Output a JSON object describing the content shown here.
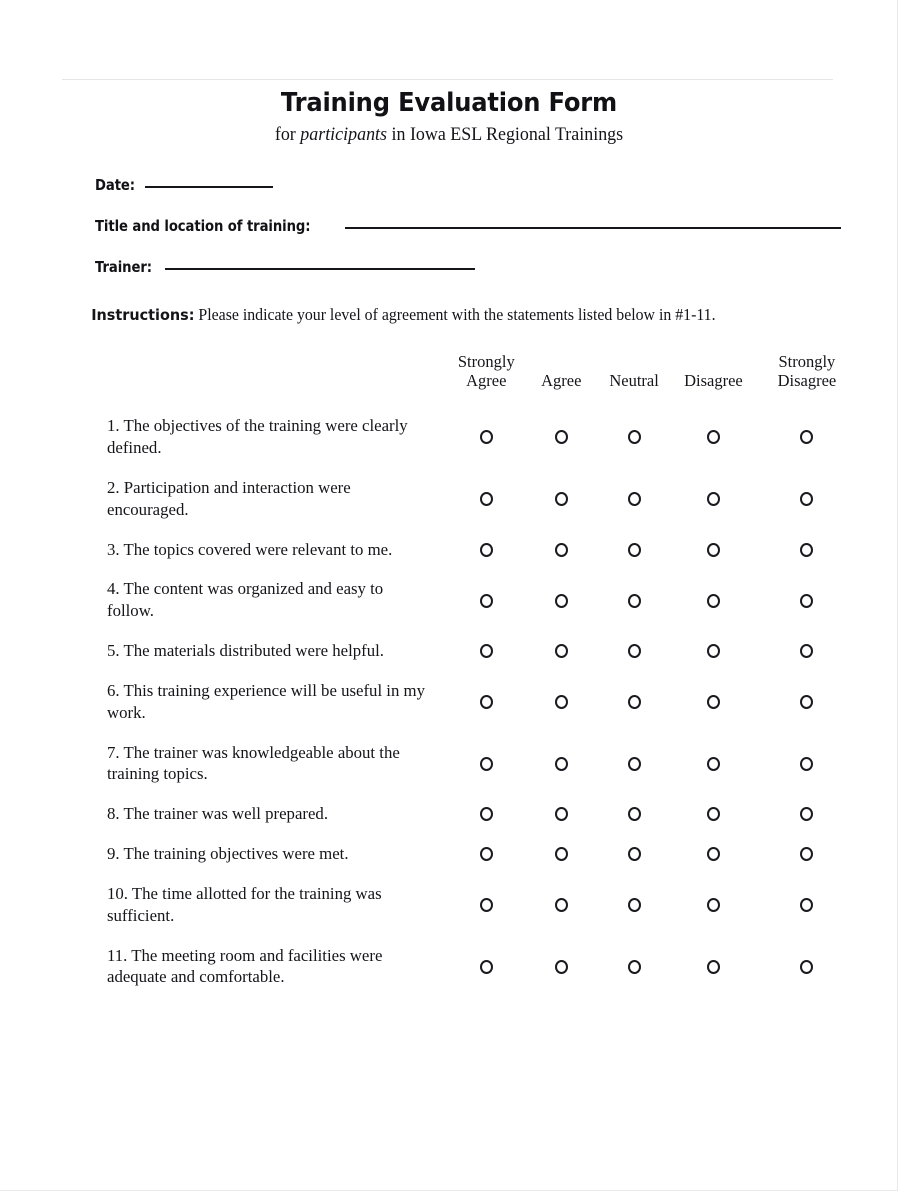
{
  "document": {
    "title": "Training Evaluation Form",
    "subtitle_pre": "for ",
    "subtitle_em": "participants",
    "subtitle_post": " in Iowa ESL Regional Trainings"
  },
  "fields": [
    {
      "label": "Date:",
      "blank": "____________",
      "value": ""
    },
    {
      "label": "Title and location of training:",
      "blank": "_____________________________________________________",
      "value": ""
    },
    {
      "label": "Trainer:",
      "blank": "________________________________",
      "value": ""
    }
  ],
  "instructions": {
    "lead": "Instructions:",
    "text": " Please indicate your level of agreement with the statements listed below in #1-11."
  },
  "scale": {
    "question_column_header": "",
    "options": [
      "Strongly Agree",
      "Agree",
      "Neutral",
      "Disagree",
      "Strongly Disagree"
    ]
  },
  "questions": [
    {
      "number": "1.",
      "text": "1. The objectives of the training were clearly defined."
    },
    {
      "number": "2.",
      "text": "2. Participation and interaction were encouraged."
    },
    {
      "number": "3.",
      "text": "3. The topics covered were relevant to me."
    },
    {
      "number": "4.",
      "text": "4. The content was organized and easy to follow."
    },
    {
      "number": "5.",
      "text": "5. The materials distributed were helpful."
    },
    {
      "number": "6.",
      "text": "6. This training experience will be useful in my work."
    },
    {
      "number": "7.",
      "text": "7. The trainer was knowledgeable about the training topics."
    },
    {
      "number": "8.",
      "text": "8. The trainer was well prepared."
    },
    {
      "number": "9.",
      "text": "9. The training objectives were met."
    },
    {
      "number": "10.",
      "text": "10. The time allotted for the training was sufficient."
    },
    {
      "number": "11.",
      "text": "11. The meeting room and facilities were adequate and comfortable."
    }
  ],
  "colors": {
    "text": "#16161a",
    "rule": "#e6e6e7",
    "page_border": "#e9e9ea"
  }
}
